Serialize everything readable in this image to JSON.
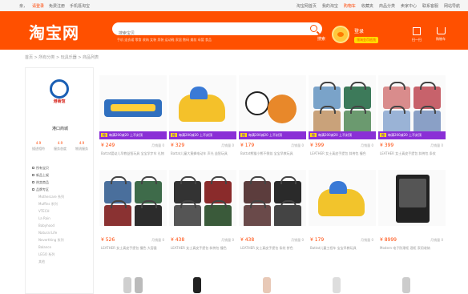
{
  "topbar": {
    "left": [
      "亲，",
      "请登录",
      "免费注册",
      "手机逛淘宝"
    ],
    "right": [
      "淘宝网首页",
      "我的淘宝",
      "购物车",
      "收藏夹",
      "商品分类",
      "卖家中心",
      "联系客服",
      "网站导航"
    ]
  },
  "header": {
    "logo": "淘宝网",
    "search_placeholder": "搜索宝贝",
    "search_label": "搜索",
    "hot_words": "手机 连衣裙 零食 收纳 女装 男装 运动鞋 家居 数码 美妆 母婴 食品",
    "user_name": "登录",
    "user_badge": "领淘金币抵钱",
    "qr_label": "扫一扫",
    "cart_label": "购物车"
  },
  "breadcrumb": "首页 > 所有分类 > 玩具乐器 > 商品列表",
  "sidebar": {
    "logo_text": "港商馆",
    "shop_name": "港口商城",
    "scores": [
      {
        "value": "4.9",
        "label": "描述相符"
      },
      {
        "value": "4.9",
        "label": "服务态度"
      },
      {
        "value": "4.9",
        "label": "物流服务"
      }
    ],
    "categories": [
      {
        "label": "所有宝贝",
        "type": "cat"
      },
      {
        "label": "新品上架",
        "type": "cat"
      },
      {
        "label": "热卖商品",
        "type": "cat"
      },
      {
        "label": "品牌专区",
        "type": "cat"
      },
      {
        "label": "Mothercare 系列",
        "type": "sub"
      },
      {
        "label": "Muffins 系列",
        "type": "sub"
      },
      {
        "label": "VTECH",
        "type": "sub"
      },
      {
        "label": "La Rain",
        "type": "sub"
      },
      {
        "label": "Babyhood",
        "type": "sub"
      },
      {
        "label": "Natural Life",
        "type": "sub"
      },
      {
        "label": "Neverthing 系列",
        "type": "sub"
      },
      {
        "label": "Balance",
        "type": "sub"
      },
      {
        "label": "LEGO 系列",
        "type": "sub"
      },
      {
        "label": "其他",
        "type": "sub"
      }
    ]
  },
  "promo_text": "每满200减20 上不封顶",
  "promo_pre": "抢",
  "products": [
    {
      "price": "¥ 249",
      "sales": "月销量 0",
      "title": "Battat婴幼儿早教益智玩具 宝宝学步车 礼物"
    },
    {
      "price": "¥ 329",
      "sales": "月销量 0",
      "title": "Battat儿童大黄蜂电动车 声光 益智玩具"
    },
    {
      "price": "¥ 179",
      "sales": "月销量 0",
      "title": "Battat熊猫小熊不倒翁 宝宝早教玩具"
    },
    {
      "price": "¥ 399",
      "sales": "月销量 0",
      "title": "LEATHER 女士真皮手提包 斜挎包 撞色"
    },
    {
      "price": "¥ 399",
      "sales": "月销量 0",
      "title": "LEATHER 女士真皮手提包 斜挎包 条纹"
    },
    {
      "price": "¥ 526",
      "sales": "月销量 0",
      "title": "LEATHER 女士真皮手提包 撞色 大容量"
    },
    {
      "price": "¥ 438",
      "sales": "月销量 0",
      "title": "LEATHER 女士真皮手提包 斜挎包 撞色"
    },
    {
      "price": "¥ 438",
      "sales": "月销量 0",
      "title": "LEATHER 女士真皮手提包 条纹 拼色"
    },
    {
      "price": "¥ 179",
      "sales": "月销量 0",
      "title": "Battat儿童工程车 宝宝早教玩具"
    },
    {
      "price": "¥ 8999",
      "sales": "月销量 0",
      "title": "Modern 电子防潮柜 酒柜 家用收纳"
    }
  ],
  "colors": {
    "brand": "#ff5000",
    "promo": "#8a2fd6",
    "price": "#ff4400"
  }
}
